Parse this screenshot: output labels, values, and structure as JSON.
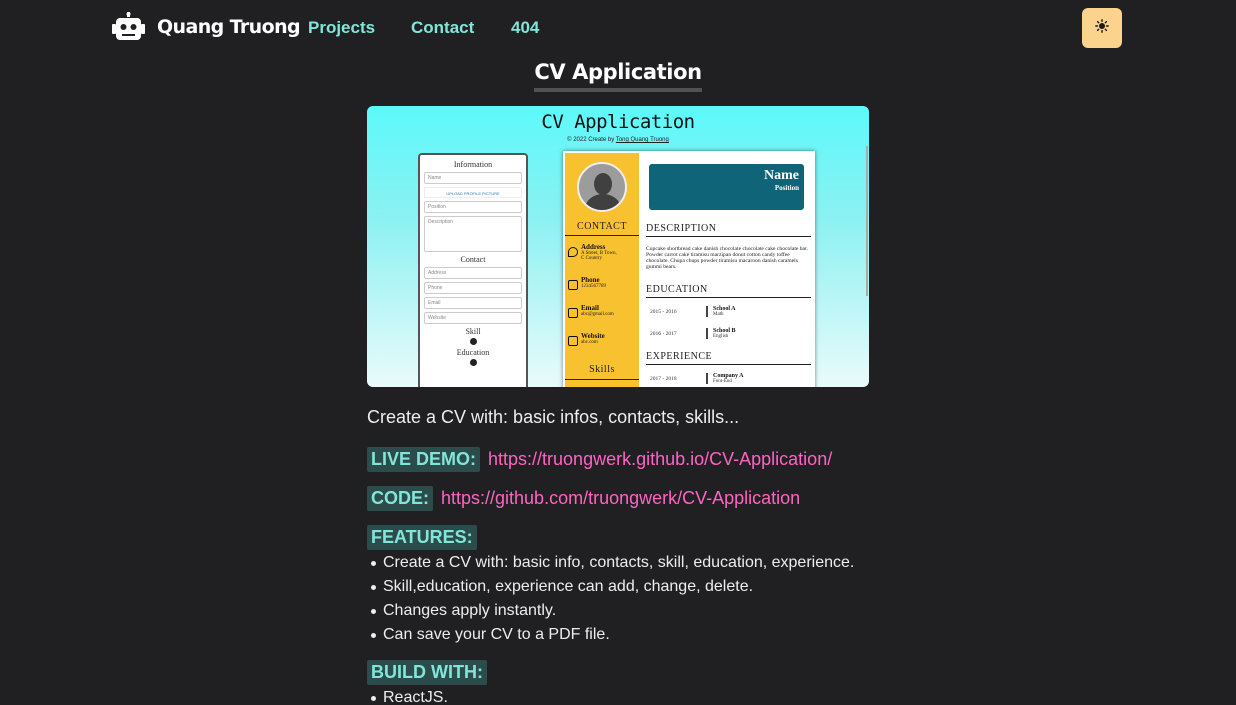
{
  "nav": {
    "brand": "Quang Truong",
    "links": [
      "Projects",
      "Contact",
      "404"
    ],
    "theme_icon": "sun-icon"
  },
  "page": {
    "title": "CV Application",
    "description": "Create a CV with: basic infos, contacts, skills...",
    "live_demo_label": "LIVE DEMO:",
    "live_demo_url": "https://truongwerk.github.io/CV-Application/",
    "code_label": "CODE:",
    "code_url": "https://github.com/truongwerk/CV-Application",
    "features_label": "FEATURES:",
    "features": [
      "Create a CV with: basic info, contacts, skill, education, experience.",
      "Skill,education, experience can add, change, delete.",
      "Changes apply instantly.",
      "Can save your CV to a PDF file."
    ],
    "build_label": "BUILD WITH:",
    "build": [
      "ReactJS."
    ]
  },
  "preview": {
    "title": "CV Application",
    "credit_prefix": "© 2022 Create by",
    "credit_name": "Tong Quang Truong",
    "form": {
      "info_heading": "Information",
      "name": "Name",
      "upload": "UPLOAD PROFILE PICTURE",
      "position": "Position",
      "description": "Description",
      "contact_heading": "Contact",
      "address": "Address",
      "phone": "Phone",
      "email": "Email",
      "website": "Website",
      "skill_heading": "Skill",
      "education_heading": "Education"
    },
    "cv": {
      "name": "Name",
      "position": "Position",
      "contact_heading": "CONTACT",
      "address_label": "Address",
      "address_value_1": "A Street, B Town,",
      "address_value_2": "C Country",
      "phone_label": "Phone",
      "phone_value": "1234567789",
      "email_label": "Email",
      "email_value": "abc@gmail.com",
      "website_label": "Website",
      "website_value": "abc.com",
      "skills_heading": "Skills",
      "description_heading": "DESCRIPTION",
      "description_text": "Cupcake shortbread cake danish chocolate chocolate cake chocolate bar. Powder carrot cake tiramisu marzipan donut cotton candy toffee chocolate. Chupa chups powder tiramisu macaroon danish caramels gummi bears.",
      "education_heading": "EDUCATION",
      "education": [
        {
          "years": "2015 - 2016",
          "school": "School A",
          "subject": "Math"
        },
        {
          "years": "2016 - 2017",
          "school": "School B",
          "subject": "English"
        }
      ],
      "experience_heading": "EXPERIENCE",
      "experience": [
        {
          "years": "2017 - 2018",
          "company": "Company A",
          "role": "Font-End"
        }
      ]
    }
  }
}
